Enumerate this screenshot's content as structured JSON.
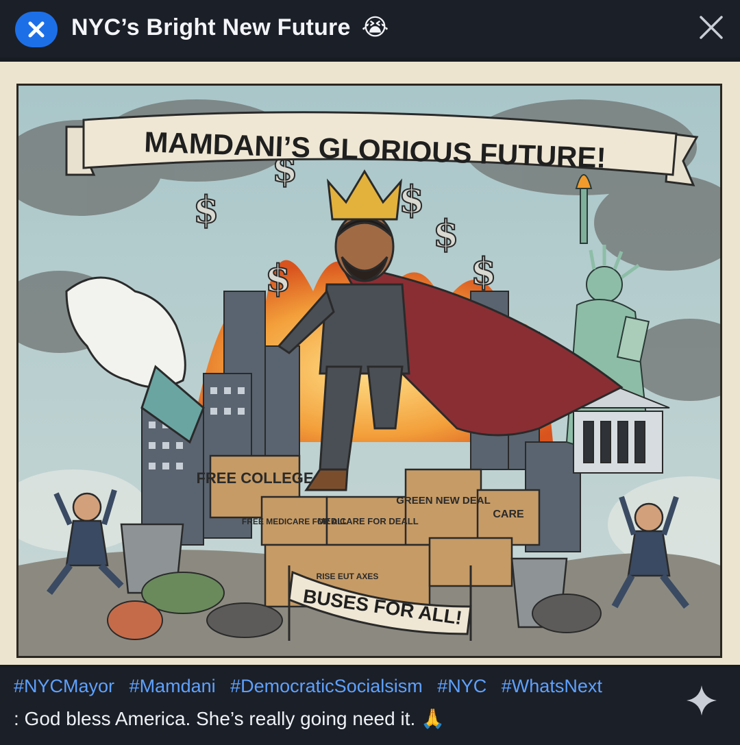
{
  "header": {
    "title": "NYC’s Bright New Future",
    "title_emoji": "😭",
    "badge_icon": "close-circle-icon",
    "close_icon": "close-icon",
    "badge_color": "#1d6fe8"
  },
  "image": {
    "banner_text": "MAMDANI’S GLORIOUS FUTURE!",
    "box_labels": [
      "FREE COLLEGE",
      "FREE MEDICARE FOR ALL",
      "MEDICARE FOR DEALL",
      "GREEN NEW DEAL",
      "CARE"
    ],
    "bottom_banner_text": "BUSES FOR ALL!",
    "small_box_text": "RISE EUT AXES"
  },
  "caption": {
    "hashtags": [
      "#NYCMayor",
      "#Mamdani",
      "#DemocraticSocialsism",
      "#NYC",
      "#WhatsNext"
    ],
    "text": ": God bless America. She’s really going need it.",
    "text_emoji": "🙏",
    "hashtag_color": "#5ea1ff",
    "sparkle_icon": "sparkle-icon"
  }
}
